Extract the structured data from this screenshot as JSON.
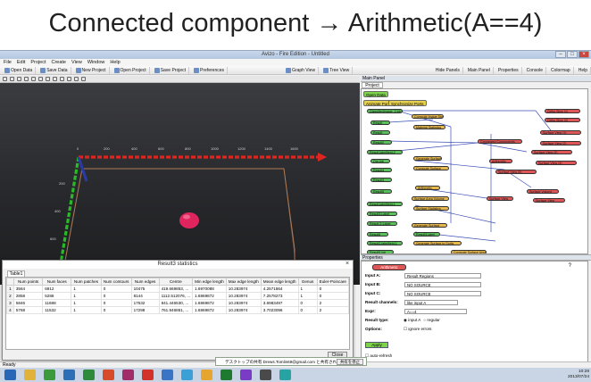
{
  "slide": {
    "title": "Connected component → Arithmetic(A==4)"
  },
  "window": {
    "title": "Avizo - Fire Edition - Untitled"
  },
  "menu": [
    "File",
    "Edit",
    "Project",
    "Create",
    "View",
    "Window",
    "Help"
  ],
  "toolbar": {
    "left": [
      "Open Data",
      "Save Data",
      "New Project",
      "Open Project",
      "Save Project",
      "Preferences"
    ],
    "mid": [
      "Graph View",
      "Tree View"
    ],
    "right": [
      "Hide Panels",
      "Main Panel",
      "Properties",
      "Console",
      "Colormap",
      "Help"
    ]
  },
  "viewer": {
    "axis_ticks_x": [
      "0",
      "200",
      "400",
      "600",
      "800",
      "1000",
      "1200",
      "1400",
      "1600"
    ],
    "axis_ticks_y": [
      "200",
      "400",
      "600",
      "800"
    ]
  },
  "dialog": {
    "title": "Result3 statistics",
    "tab": "Table1",
    "close_label": "Close",
    "columns": [
      "",
      "Num points",
      "Num faces",
      "Num patches",
      "Num contours",
      "Num edges",
      "Centre",
      "Min edge length",
      "Max edge length",
      "Mean edge length",
      "Genus",
      "Euler-Poincare"
    ],
    "rows": [
      [
        "1",
        "3564",
        "6912",
        "1",
        "0",
        "10475",
        "419.669853, ...",
        "1.6970088",
        "10.283974",
        "4.2571864",
        "1",
        "0"
      ],
      [
        "2",
        "2858",
        "5286",
        "1",
        "0",
        "8144",
        "1112.512076, ...",
        "1.6869872",
        "10.283974",
        "7.2578273",
        "1",
        "0"
      ],
      [
        "3",
        "5846",
        "11688",
        "1",
        "0",
        "17532",
        "841.446530, ...",
        "1.6869872",
        "10.283974",
        "3.6983497",
        "0",
        "2"
      ],
      [
        "4",
        "5768",
        "11532",
        "1",
        "0",
        "17298",
        "761.946851, ...",
        "1.6869872",
        "10.283974",
        "3.7023096",
        "0",
        "2"
      ]
    ]
  },
  "main_panel": {
    "title": "Main Panel",
    "tab": "Project View",
    "buttons": [
      "Open Data",
      "Animate Ports",
      "Synchronize Ports"
    ],
    "green_nodes": [
      "ClassifiedImage_2.lob",
      "Result",
      "Result",
      "Result2",
      "Result-labelfield-2",
      "Ore.lob",
      "Result4",
      "Result3",
      "Result5",
      "Result-labelfield-1",
      "Result3-Label",
      "Result-2-Label",
      "Result6",
      "Result2-labelfield-1",
      "Result5.lob",
      "Result3-label"
    ],
    "yellow_nodes": [
      "Compute Image Stats",
      "Material Statistics",
      "Generate Surface",
      "Compute Surface",
      "Arithmetic",
      "Surface Area Volume",
      "Surface Statistics",
      "Generate Surface",
      "Generate Surface to Surfa",
      "Compute Surface Area"
    ],
    "red_nodes": [
      "Ortho Slice (1)",
      "Ortho Slice (2)",
      "Connected Components",
      "Surface View (1)",
      "Surface View (2)",
      "Surface View (3)",
      "Surface View (4)",
      "Surface View (5)",
      "Arithmetic",
      "Surface View",
      "Surface Volume",
      "Surface View"
    ]
  },
  "properties": {
    "title": "Properties",
    "node": "Arithmetic",
    "fields": [
      {
        "label": "Input A:",
        "value": "Result Regions"
      },
      {
        "label": "Input B:",
        "value": "NO SOURCE"
      },
      {
        "label": "Input C:",
        "value": "NO SOURCE"
      },
      {
        "label": "Result channels:",
        "value": "like input A"
      },
      {
        "label": "Expr:",
        "value": "A==4"
      },
      {
        "label": "Result type:",
        "value": ""
      },
      {
        "label": "Options:",
        "value": ""
      }
    ],
    "radio_options": [
      "input A",
      "regular"
    ],
    "checkbox_option": "ignore errors",
    "auto_refresh": "auto-refresh",
    "apply_label": "Apply"
  },
  "status": {
    "text": "Ready"
  },
  "toast": {
    "text": "デスクトップの共有 Drews.Tomlin69@gmail.com と共有されています。",
    "button": "共有を停止"
  },
  "tray": {
    "time": "10:28",
    "date": "2013/07/24"
  },
  "colors": {
    "axis_x": "#e0241f",
    "axis_y": "#29b929",
    "axis_z": "#2a3aa8",
    "sphere": "#e0245e",
    "box": "#b07a54"
  }
}
